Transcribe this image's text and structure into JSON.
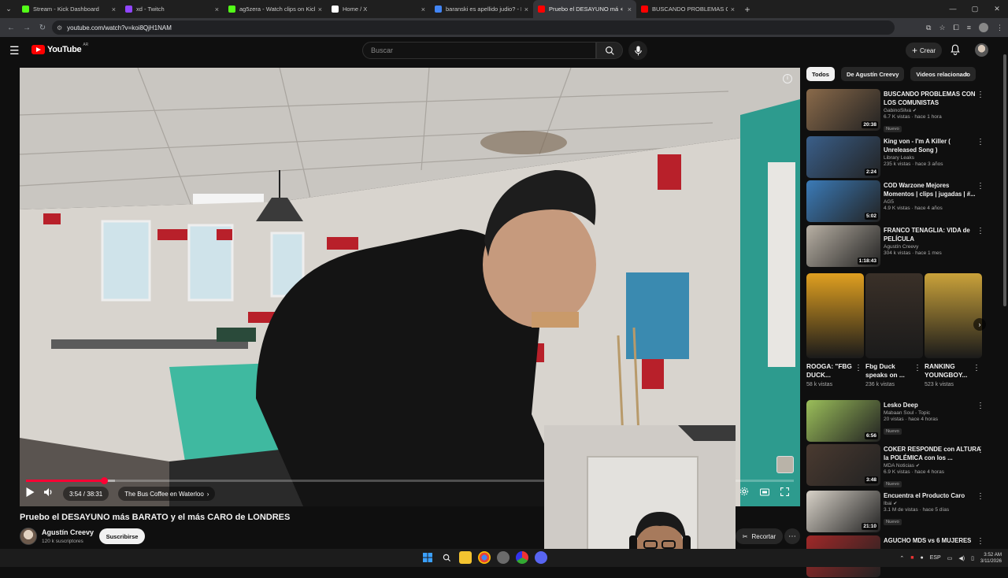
{
  "browser": {
    "tabs": [
      {
        "label": "Stream - Kick Dashboard",
        "color": "#53fc18"
      },
      {
        "label": "xd - Twitch",
        "color": "#9146ff"
      },
      {
        "label": "ag5zera - Watch clips on Kick",
        "color": "#53fc18"
      },
      {
        "label": "Home / X",
        "color": "#ffffff"
      },
      {
        "label": "baranski es apellido judio? - Bu",
        "color": "#4285f4"
      },
      {
        "label": "Pruebo el DESAYUNO más",
        "color": "#ff0000"
      },
      {
        "label": "BUSCANDO PROBLEMAS CON",
        "color": "#ff0000"
      }
    ],
    "active_tab": 5,
    "url": "youtube.com/watch?v=koi8QjH1NAM"
  },
  "youtube": {
    "logo_text": "YouTube",
    "country_code": "AR",
    "search_placeholder": "Buscar",
    "create_label": "Crear"
  },
  "player": {
    "current_time": "3:54",
    "duration": "38:31",
    "time_display": "3:54 / 38:31",
    "chapter": "The Bus Coffee en Waterloo",
    "progress_fraction": 0.1013,
    "buffered_fraction": 0.116
  },
  "video": {
    "title": "Pruebo el DESAYUNO más BARATO y el más CARO de LONDRES",
    "channel": "Agustín Creevy",
    "subscribers": "120 k suscriptores",
    "subscribe_label": "Suscribirse",
    "clip_label": "Recortar"
  },
  "sidebar": {
    "chips": [
      "Todos",
      "De Agustín Creevy",
      "Videos relacionado"
    ],
    "recommendations": [
      {
        "title": "BUSCANDO PROBLEMAS CON LOS COMUNISTAS",
        "channel": "GabinoSilva",
        "verified": true,
        "stats": "6.7 K vistas · hace 1 hora",
        "duration": "20:38",
        "badge": "Nuevo",
        "thumb": "#8a6a4a"
      },
      {
        "title": "King von - I'm A Killer ( Unreleased Song )",
        "channel": "Library Leaks",
        "verified": false,
        "stats": "235 k vistas · hace 3 años",
        "duration": "2:24",
        "badge": "",
        "thumb": "#3a5f8a"
      },
      {
        "title": "COD Warzone Mejores Momentos | clips | jugadas | #...",
        "channel": "AG5",
        "verified": false,
        "stats": "4.9 K vistas · hace 4 años",
        "duration": "5:02",
        "badge": "",
        "thumb": "#3b7bb8"
      },
      {
        "title": "FRANCO TENAGLIA: VIDA de PELÍCULA",
        "channel": "Agustín Creevy",
        "verified": false,
        "stats": "304 k vistas · hace 1 mes",
        "duration": "1:18:43",
        "badge": "",
        "thumb": "#b8b0a4"
      },
      {
        "title": "Lesko Deep",
        "channel": "Mabaan Soul - Topic",
        "verified": false,
        "stats": "20 vistas · hace 4 horas",
        "duration": "6:56",
        "badge": "Nuevo",
        "thumb": "#9bbf5a"
      },
      {
        "title": "COKER RESPONDE con ALTURA la POLÉMICA con los ...",
        "channel": "MDA Noticias",
        "verified": true,
        "stats": "6.9 K vistas · hace 4 horas",
        "duration": "3:48",
        "badge": "Nuevo",
        "thumb": "#4a3a30"
      },
      {
        "title": "Encuentra el Producto Caro",
        "channel": "Ibai",
        "verified": true,
        "stats": "3.1 M de vistas · hace 5 días",
        "duration": "21:10",
        "badge": "Nuevo",
        "thumb": "#d8d2c8"
      },
      {
        "title": "AGUCHO MDS vs 6 MUJERES",
        "channel": "",
        "verified": false,
        "stats": "",
        "duration": "",
        "badge": "",
        "thumb": "#a02828"
      }
    ],
    "shorts": [
      {
        "title": "ROOGA: \"FBG DUCK...",
        "views": "58 k vistas",
        "thumb": "#e0a020"
      },
      {
        "title": "Fbg Duck speaks on ...",
        "views": "236 k vistas",
        "thumb": "#3a3028"
      },
      {
        "title": "RANKING YOUNGBOY...",
        "views": "523 k vistas",
        "thumb": "#caa23a"
      }
    ]
  },
  "taskbar": {
    "lang": "ESP",
    "time": "3:52 AM",
    "date": "3/11/2026"
  }
}
